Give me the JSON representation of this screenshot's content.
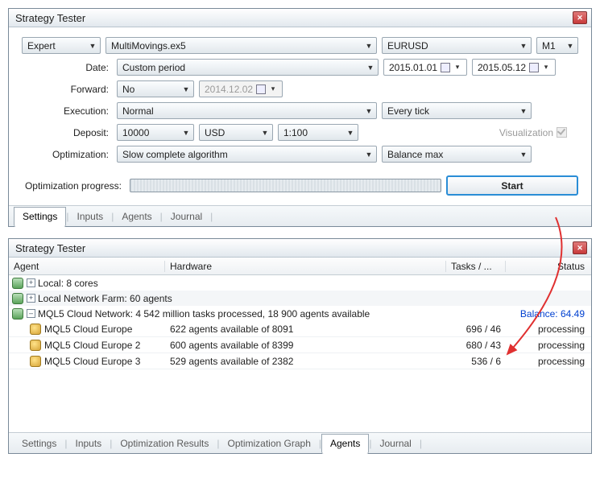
{
  "top": {
    "title": "Strategy Tester",
    "expert_combo_label": "Expert",
    "expert_file": "MultiMovings.ex5",
    "symbol": "EURUSD",
    "timeframe": "M1",
    "labels": {
      "date": "Date:",
      "forward": "Forward:",
      "execution": "Execution:",
      "deposit": "Deposit:",
      "optimization": "Optimization:",
      "opt_progress": "Optimization progress:"
    },
    "date_mode": "Custom period",
    "date_from": "2015.01.01",
    "date_to": "2015.05.12",
    "forward_mode": "No",
    "forward_date": "2014.12.02",
    "execution_mode": "Normal",
    "tick_mode": "Every tick",
    "deposit_amount": "10000",
    "deposit_currency": "USD",
    "leverage": "1:100",
    "visualization_label": "Visualization",
    "opt_algo": "Slow complete algorithm",
    "opt_criterion": "Balance max",
    "start_btn": "Start",
    "tabs": [
      "Settings",
      "Inputs",
      "Agents",
      "Journal"
    ],
    "active_tab": 0
  },
  "bottom": {
    "title": "Strategy Tester",
    "columns": {
      "agent": "Agent",
      "hardware": "Hardware",
      "tasks": "Tasks / ...",
      "status": "Status"
    },
    "nodes": {
      "local": "Local: 8 cores",
      "farm": "Local Network Farm: 60 agents",
      "cloud": "MQL5 Cloud Network: 4 542 million tasks processed, 18 900 agents available",
      "balance_label": "Balance: ",
      "balance_value": "64.49"
    },
    "agents": [
      {
        "name": "MQL5 Cloud Europe",
        "hw": "622 agents available of 8091",
        "tasks": "696 / 46",
        "status": "processing"
      },
      {
        "name": "MQL5 Cloud Europe 2",
        "hw": "600 agents available of 8399",
        "tasks": "680 / 43",
        "status": "processing"
      },
      {
        "name": "MQL5 Cloud Europe 3",
        "hw": "529 agents available of 2382",
        "tasks": "536 / 6",
        "status": "processing"
      }
    ],
    "tabs": [
      "Settings",
      "Inputs",
      "Optimization Results",
      "Optimization Graph",
      "Agents",
      "Journal"
    ],
    "active_tab": 4
  }
}
